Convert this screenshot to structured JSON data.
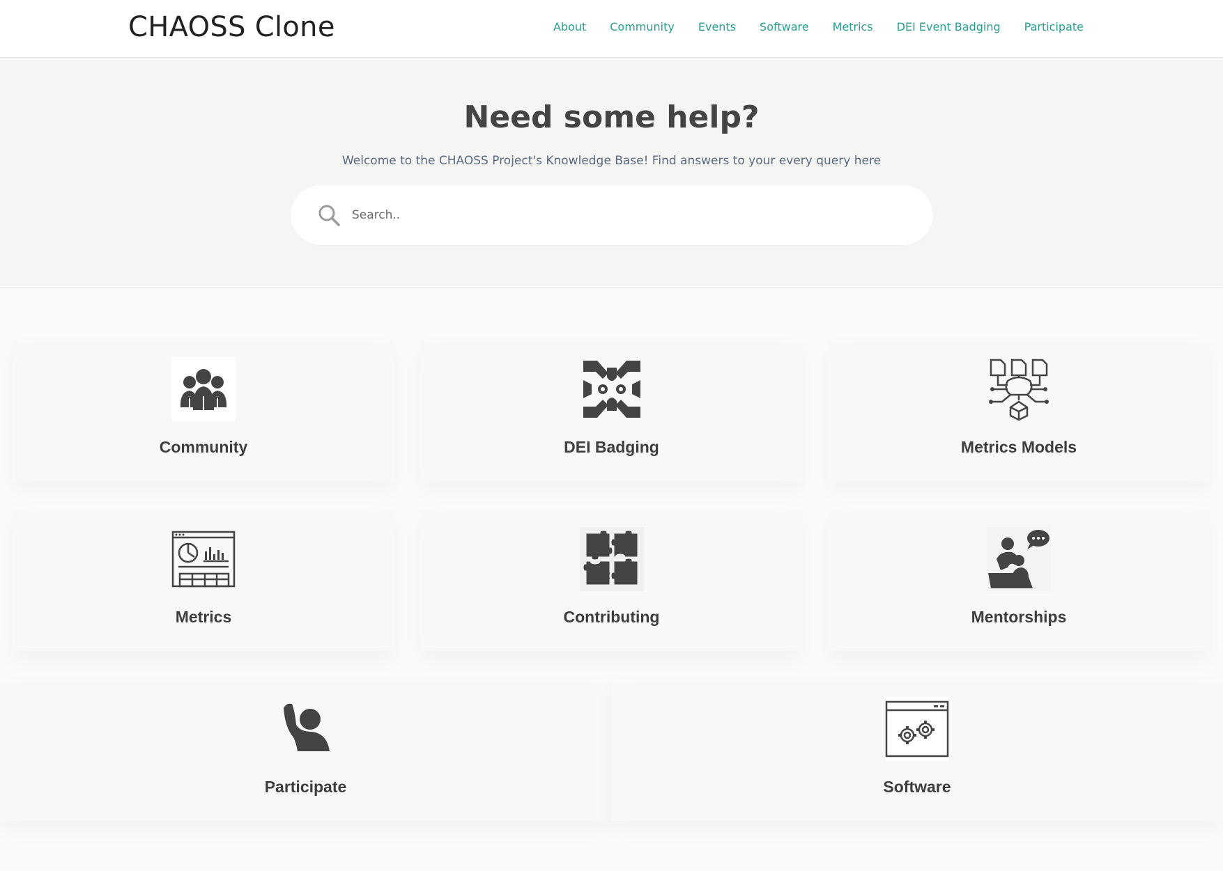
{
  "header": {
    "logo": "CHAOSS Clone",
    "nav": [
      "About",
      "Community",
      "Events",
      "Software",
      "Metrics",
      "DEI Event Badging",
      "Participate"
    ]
  },
  "hero": {
    "title": "Need some help?",
    "subtitle": "Welcome to the CHAOSS Project's Knowledge Base! Find answers to your every query here",
    "search_placeholder": "Search.."
  },
  "cards": [
    {
      "label": "Community",
      "icon": "people-group-icon"
    },
    {
      "label": "DEI Badging",
      "icon": "hands-together-icon"
    },
    {
      "label": "Metrics Models",
      "icon": "network-model-icon"
    },
    {
      "label": "Metrics",
      "icon": "dashboard-icon"
    },
    {
      "label": "Contributing",
      "icon": "puzzle-pieces-icon"
    },
    {
      "label": "Mentorships",
      "icon": "mentor-chat-icon"
    },
    {
      "label": "Participate",
      "icon": "raised-hand-icon"
    },
    {
      "label": "Software",
      "icon": "browser-gears-icon"
    }
  ],
  "colors": {
    "nav_link": "#2a9d8f",
    "hero_bg": "#f5f5f3",
    "icon": "#444444"
  }
}
